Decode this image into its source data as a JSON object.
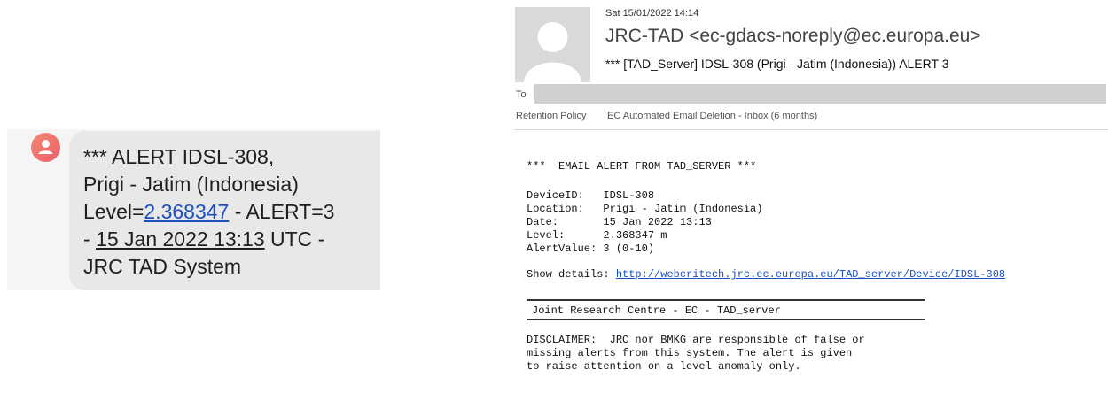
{
  "sms": {
    "line1": "*** ALERT IDSL-308,",
    "line2": "Prigi - Jatim (Indonesia)",
    "line3_prefix": "Level=",
    "line3_link": "2.368347",
    "line3_suffix": " - ALERT=3",
    "line4_prefix": "- ",
    "line4_date": "15 Jan 2022 13:13",
    "line4_suffix": " UTC -",
    "line5": "JRC TAD System",
    "avatar_icon": "person-icon"
  },
  "email": {
    "date": "Sat 15/01/2022 14:14",
    "from": "JRC-TAD <ec-gdacs-noreply@ec.europa.eu>",
    "subject": "*** [TAD_Server] IDSL-308 (Prigi - Jatim (Indonesia)) ALERT 3",
    "to_label": "To",
    "retention_label": "Retention Policy",
    "retention_value": "EC Automated Email Deletion - Inbox (6 months)",
    "body": {
      "heading": "***  EMAIL ALERT FROM TAD_SERVER ***",
      "fields": [
        {
          "label": "DeviceID:   ",
          "value": "IDSL-308"
        },
        {
          "label": "Location:   ",
          "value": "Prigi - Jatim (Indonesia)"
        },
        {
          "label": "Date:       ",
          "value": "15 Jan 2022 13:13"
        },
        {
          "label": "Level:      ",
          "value": "2.368347 m"
        },
        {
          "label": "AlertValue: ",
          "value": "3 (0-10)"
        }
      ],
      "details_label": "Show details: ",
      "details_link": "http://webcritech.jrc.ec.europa.eu/TAD_server/Device/IDSL-308",
      "footer_title": "Joint Research Centre - EC - TAD_server",
      "disclaimer": [
        "DISCLAIMER:  JRC nor BMKG are responsible of false or",
        "missing alerts from this system. The alert is given",
        "to raise attention on a level anomaly only."
      ]
    }
  }
}
